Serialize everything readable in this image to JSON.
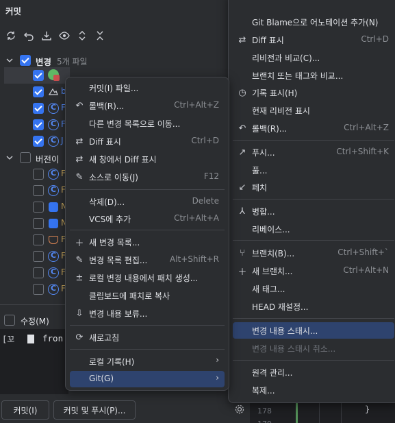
{
  "panel": {
    "title": "커밋"
  },
  "tree": {
    "changes_group": {
      "label": "변경",
      "count": "5개 파일"
    },
    "unversioned_group": {
      "label": "버전이"
    },
    "changed_files": [
      "",
      "b",
      "F",
      "F",
      "J"
    ],
    "unversioned_files": [
      "F",
      "F",
      "N",
      "N",
      "F",
      "F",
      "F",
      "F"
    ]
  },
  "bottom": {
    "amend_label": "수정(M)",
    "editor_text": "fron",
    "commit_button": "커밋(I)",
    "commit_push_button": "커밋 및 푸시(P)...",
    "line_numbers": [
      "178",
      "179"
    ],
    "brace": "}"
  },
  "left_menu": {
    "items": [
      {
        "label": "커밋(I) 파일...",
        "shortcut": "",
        "icon": ""
      },
      {
        "label": "롤백(R)...",
        "shortcut": "Ctrl+Alt+Z",
        "icon": "undo-icon"
      },
      {
        "label": "다른 변경 목록으로 이동...",
        "shortcut": "",
        "icon": ""
      },
      {
        "label": "Diff 표시",
        "shortcut": "Ctrl+D",
        "icon": "diff-icon"
      },
      {
        "label": "새 창에서 Diff 표시",
        "shortcut": "",
        "icon": "diff-icon"
      },
      {
        "label": "소스로 이동(J)",
        "shortcut": "F12",
        "icon": "pencil-icon"
      },
      {
        "label": "삭제(D)...",
        "shortcut": "Delete",
        "icon": ""
      },
      {
        "label": "VCS에 추가",
        "shortcut": "Ctrl+Alt+A",
        "icon": ""
      },
      {
        "label": "새 변경 목록...",
        "shortcut": "",
        "icon": "plus-icon"
      },
      {
        "label": "변경 목록 편집...",
        "shortcut": "Alt+Shift+R",
        "icon": "pencil-icon"
      },
      {
        "label": "로컬 변경 내용에서 패치 생성...",
        "shortcut": "",
        "icon": "patch-icon"
      },
      {
        "label": "클립보드에 패치로 복사",
        "shortcut": "",
        "icon": ""
      },
      {
        "label": "변경 내용 보류...",
        "shortcut": "",
        "icon": "shelve-icon"
      },
      {
        "label": "새로고침",
        "shortcut": "",
        "icon": "refresh-icon"
      },
      {
        "label": "로컬 기록(H)",
        "shortcut": "",
        "icon": ""
      },
      {
        "label": "Git(G)",
        "shortcut": "",
        "icon": ""
      }
    ]
  },
  "right_menu": {
    "items": [
      {
        "label": "Git Blame으로 어노테이션 추가(N)",
        "shortcut": "",
        "icon": ""
      },
      {
        "label": "Diff 표시",
        "shortcut": "Ctrl+D",
        "icon": "diff-icon"
      },
      {
        "label": "리비전과 비교(C)...",
        "shortcut": "",
        "icon": ""
      },
      {
        "label": "브랜치 또는 태그와 비교...",
        "shortcut": "",
        "icon": ""
      },
      {
        "label": "기록 표시(H)",
        "shortcut": "",
        "icon": "clock-icon"
      },
      {
        "label": "현재 리비전 표시",
        "shortcut": "",
        "icon": ""
      },
      {
        "label": "롤백(R)...",
        "shortcut": "Ctrl+Alt+Z",
        "icon": "undo-icon"
      },
      {
        "label": "푸시...",
        "shortcut": "Ctrl+Shift+K",
        "icon": "push-icon"
      },
      {
        "label": "풀...",
        "shortcut": "",
        "icon": ""
      },
      {
        "label": "페치",
        "shortcut": "",
        "icon": "fetch-icon"
      },
      {
        "label": "병합...",
        "shortcut": "",
        "icon": "merge-icon"
      },
      {
        "label": "리베이스...",
        "shortcut": "",
        "icon": ""
      },
      {
        "label": "브랜치(B)...",
        "shortcut": "Ctrl+Shift+`",
        "icon": "branch-icon"
      },
      {
        "label": "새 브랜치...",
        "shortcut": "Ctrl+Alt+N",
        "icon": "plus-icon"
      },
      {
        "label": "새 태그...",
        "shortcut": "",
        "icon": ""
      },
      {
        "label": "HEAD 재설정...",
        "shortcut": "",
        "icon": ""
      },
      {
        "label": "변경 내용 스태시...",
        "shortcut": "",
        "icon": ""
      },
      {
        "label": "변경 내용 스태시 취소...",
        "shortcut": "",
        "icon": ""
      },
      {
        "label": "원격 관리...",
        "shortcut": "",
        "icon": ""
      },
      {
        "label": "복제...",
        "shortcut": "",
        "icon": ""
      }
    ]
  }
}
